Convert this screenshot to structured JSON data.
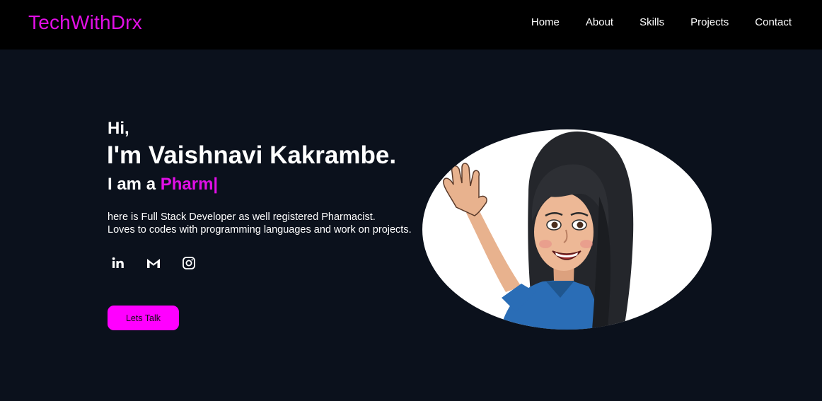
{
  "header": {
    "logo": "TechWithDrx",
    "nav": [
      "Home",
      "About",
      "Skills",
      "Projects",
      "Contact"
    ]
  },
  "hero": {
    "greeting": "Hi,",
    "name": "I'm Vaishnavi Kakrambe.",
    "role_prefix": "I am a",
    "role_word": "Pharm",
    "cursor": "|",
    "description_line1": "here is Full Stack Developer as well registered Pharmacist.",
    "description_line2": "Loves to codes with programming languages and work on projects.",
    "socials": [
      "linkedin-icon",
      "gmail-icon",
      "instagram-icon"
    ],
    "cta_label": "Lets Talk"
  },
  "colors": {
    "accent": "#e10fe6",
    "button": "#ff00ff",
    "navbar": "#000000",
    "background": "#0b111c",
    "text": "#ffffff"
  }
}
